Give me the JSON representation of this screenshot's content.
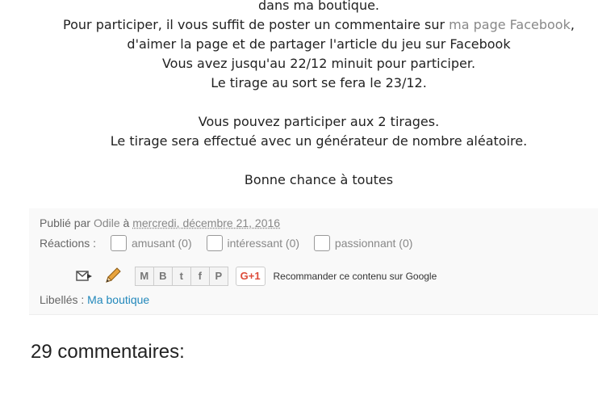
{
  "post": {
    "line1": "dans ma boutique.",
    "line2_before": "Pour participer, il vous suffit de poster un commentaire sur ",
    "line2_link": "ma page Facebook",
    "line2_after": ",",
    "line3": "d'aimer la page et de partager l'article du jeu sur Facebook",
    "line4": "Vous avez jusqu'au 22/12 minuit pour participer.",
    "line5": "Le tirage au sort se fera le 23/12.",
    "line6": "Vous pouvez participer aux 2 tirages.",
    "line7": "Le tirage sera effectué avec un générateur de nombre aléatoire.",
    "line8": "Bonne chance à toutes"
  },
  "footer": {
    "published_prefix": "Publié par",
    "author": "Odile",
    "at": "à",
    "date": "mercredi, décembre 21, 2016",
    "reactions_label": "Réactions :",
    "reactions": [
      {
        "label": "amusant (0)"
      },
      {
        "label": "intéressant (0)"
      },
      {
        "label": "passionnant (0)"
      }
    ],
    "share_buttons": [
      {
        "glyph": "M",
        "icon": "email-icon"
      },
      {
        "glyph": "B",
        "icon": "blogger-icon"
      },
      {
        "glyph": "t",
        "icon": "twitter-icon"
      },
      {
        "glyph": "f",
        "icon": "facebook-icon"
      },
      {
        "glyph": "P",
        "icon": "pinterest-icon"
      }
    ],
    "gplus_label": "G+1",
    "gplus_text": "Recommander ce contenu sur Google",
    "labels_prefix": "Libellés :",
    "labels_link": "Ma boutique"
  },
  "comments": {
    "title": "29 commentaires:"
  },
  "colors": {
    "link_gray": "#888888",
    "link_blue": "#2288bb",
    "gplus_red": "#dd4b39",
    "footer_bg": "#f9f9f9"
  }
}
